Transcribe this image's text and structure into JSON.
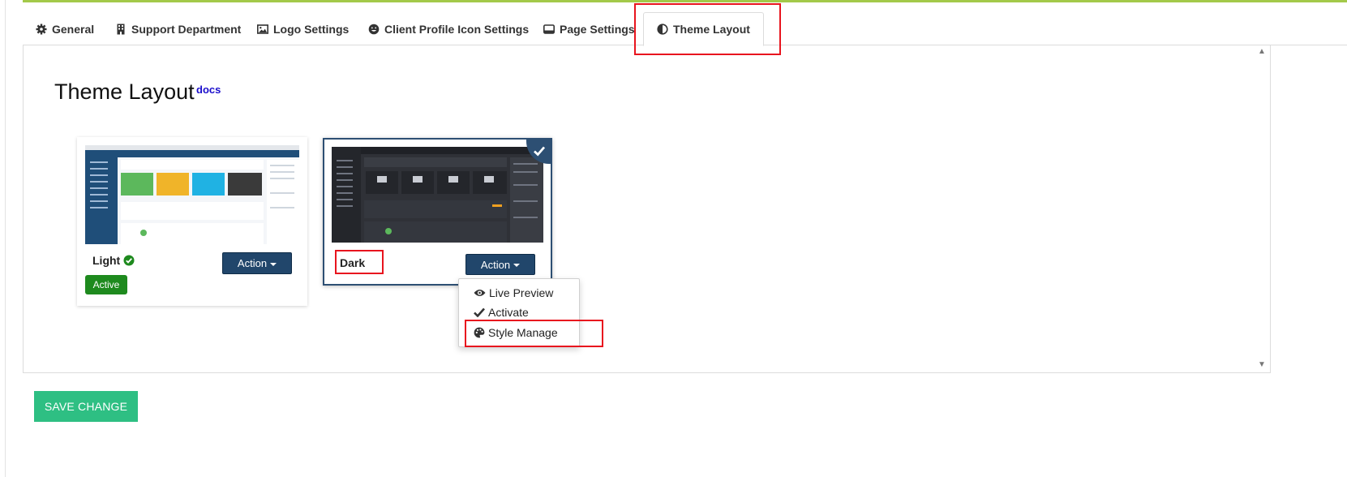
{
  "tabs": [
    {
      "label": "General",
      "icon": "gear-icon"
    },
    {
      "label": "Support Department",
      "icon": "building-icon"
    },
    {
      "label": "Logo Settings",
      "icon": "image-icon"
    },
    {
      "label": "Client Profile Icon Settings",
      "icon": "smile-icon"
    },
    {
      "label": "Page Settings",
      "icon": "window-icon"
    },
    {
      "label": "Theme Layout",
      "icon": "contrast-icon",
      "active": true
    }
  ],
  "main": {
    "title": "Theme Layout",
    "docs_label": "docs"
  },
  "themes": [
    {
      "name": "Light",
      "status": "Active",
      "action_label": "Action",
      "selected": false
    },
    {
      "name": "Dark",
      "action_label": "Action",
      "selected": true
    }
  ],
  "dropdown": {
    "items": [
      {
        "label": "Live Preview",
        "icon": "eye-icon"
      },
      {
        "label": "Activate",
        "icon": "check-icon"
      },
      {
        "label": "Style Manage",
        "icon": "palette-icon"
      }
    ]
  },
  "footer": {
    "save_label": "SAVE CHANGE"
  },
  "colors": {
    "accent_navy": "#21466b",
    "save_green": "#2ebf83",
    "active_green": "#1e8a1e",
    "highlight_red": "#e8141e"
  }
}
